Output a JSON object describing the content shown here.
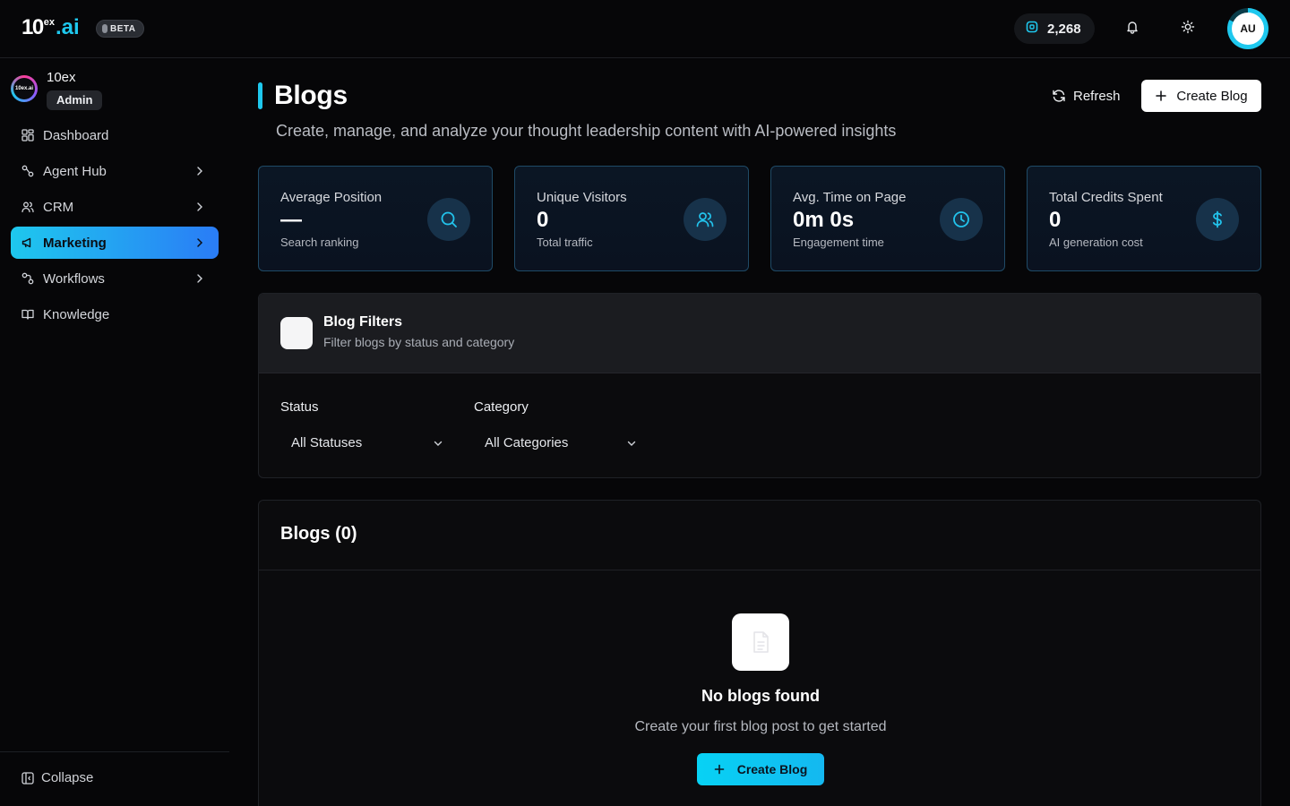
{
  "brand": {
    "logo_main": "10",
    "logo_sup": "ex",
    "logo_suffix": ".ai",
    "badge": "BETA",
    "accent": "#1ec8ee"
  },
  "topbar": {
    "credits": "2,268",
    "avatar_initials": "AU"
  },
  "org": {
    "name": "10ex",
    "role": "Admin",
    "logo_text": "10ex.ai"
  },
  "sidebar": {
    "items": [
      {
        "label": "Dashboard",
        "icon": "dashboard-icon",
        "has_chevron": false,
        "active": false
      },
      {
        "label": "Agent Hub",
        "icon": "agent-hub-icon",
        "has_chevron": true,
        "active": false
      },
      {
        "label": "CRM",
        "icon": "users-icon",
        "has_chevron": true,
        "active": false
      },
      {
        "label": "Marketing",
        "icon": "megaphone-icon",
        "has_chevron": true,
        "active": true
      },
      {
        "label": "Workflows",
        "icon": "workflow-icon",
        "has_chevron": true,
        "active": false
      },
      {
        "label": "Knowledge",
        "icon": "book-icon",
        "has_chevron": false,
        "active": false
      }
    ],
    "collapse_label": "Collapse"
  },
  "page": {
    "title": "Blogs",
    "subtitle": "Create, manage, and analyze your thought leadership content with AI-powered insights",
    "refresh_label": "Refresh",
    "create_label": "Create Blog"
  },
  "stats": [
    {
      "label": "Average Position",
      "value": "—",
      "sub": "Search ranking",
      "icon": "search-icon"
    },
    {
      "label": "Unique Visitors",
      "value": "0",
      "sub": "Total traffic",
      "icon": "users-icon"
    },
    {
      "label": "Avg. Time on Page",
      "value": "0m 0s",
      "sub": "Engagement time",
      "icon": "clock-icon"
    },
    {
      "label": "Total Credits Spent",
      "value": "0",
      "sub": "AI generation cost",
      "icon": "dollar-icon"
    }
  ],
  "filters": {
    "title": "Blog Filters",
    "subtitle": "Filter blogs by status and category",
    "status_label": "Status",
    "status_value": "All Statuses",
    "category_label": "Category",
    "category_value": "All Categories"
  },
  "blogs": {
    "title": "Blogs (0)",
    "empty_title": "No blogs found",
    "empty_sub": "Create your first blog post to get started",
    "empty_button": "Create Blog"
  }
}
